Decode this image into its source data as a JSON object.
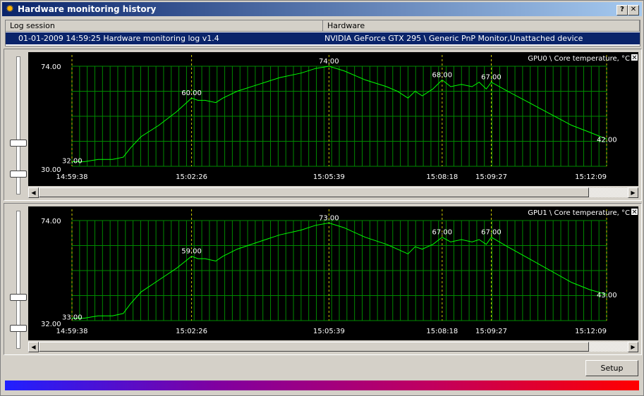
{
  "window": {
    "title": "Hardware monitoring history",
    "help_label": "?",
    "close_label": "✕",
    "app_icon": "gear-icon"
  },
  "table": {
    "col_session": "Log session",
    "col_hardware": "Hardware",
    "row": {
      "session": "01-01-2009 14:59:25 Hardware monitoring log v1.4",
      "hardware": "NVIDIA GeForce GTX 295 \\ Generic PnP Monitor,Unattached device"
    }
  },
  "colors": {
    "graph_bg": "#000000",
    "grid": "#008800",
    "curve": "#00ff00",
    "marker": "#cccc00",
    "text": "#ffffff"
  },
  "setup_label": "Setup",
  "chart_data": [
    {
      "type": "line",
      "title": "GPU0 \\ Core temperature, °C",
      "close_label": "✕",
      "ylim": [
        30,
        74
      ],
      "y_max_label": "74.00",
      "y_min_label": "30.00",
      "x_ticks": [
        "14:59:38",
        "15:02:26",
        "15:05:39",
        "15:08:18",
        "15:09:27",
        "15:12:09"
      ],
      "x_tick_times": [
        "14:59:38",
        "15:02:26",
        "15:05:39",
        "15:08:18",
        "15:09:27",
        "15:12:09"
      ],
      "series": [
        {
          "times": [
            "14:59:38",
            "14:59:55",
            "15:00:15",
            "15:00:35",
            "15:00:50",
            "15:01:00",
            "15:01:15",
            "15:01:40",
            "15:02:05",
            "15:02:26",
            "15:02:35",
            "15:02:45",
            "15:03:00",
            "15:03:10",
            "15:03:30",
            "15:04:00",
            "15:04:30",
            "15:05:00",
            "15:05:20",
            "15:05:39",
            "15:06:00",
            "15:06:30",
            "15:07:00",
            "15:07:15",
            "15:07:30",
            "15:07:40",
            "15:07:50",
            "15:08:05",
            "15:08:18",
            "15:08:30",
            "15:08:45",
            "15:09:00",
            "15:09:10",
            "15:09:20",
            "15:09:27",
            "15:09:50",
            "15:10:20",
            "15:10:50",
            "15:11:20",
            "15:11:45",
            "15:12:09"
          ],
          "values": [
            32,
            32,
            33,
            33,
            34,
            38,
            43,
            48,
            54,
            60,
            59,
            59,
            58,
            60,
            63,
            66,
            69,
            71,
            73,
            74,
            72,
            68,
            65,
            63,
            60,
            63,
            61,
            64,
            68,
            65,
            66,
            65,
            67,
            64,
            67,
            63,
            58,
            53,
            48,
            45,
            42
          ]
        }
      ],
      "markers": [
        {
          "time": "14:59:38",
          "label": "32.00"
        },
        {
          "time": "15:02:26",
          "label": "60.00"
        },
        {
          "time": "15:05:39",
          "label": "74.00"
        },
        {
          "time": "15:08:18",
          "label": "68.00"
        },
        {
          "time": "15:09:27",
          "label": "67.00"
        },
        {
          "time": "15:12:09",
          "label": "42.00"
        }
      ]
    },
    {
      "type": "line",
      "title": "GPU1 \\ Core temperature, °C",
      "close_label": "✕",
      "ylim": [
        32,
        74
      ],
      "y_max_label": "74.00",
      "y_min_label": "32.00",
      "x_ticks": [
        "14:59:38",
        "15:02:26",
        "15:05:39",
        "15:08:18",
        "15:09:27",
        "15:12:09"
      ],
      "x_tick_times": [
        "14:59:38",
        "15:02:26",
        "15:05:39",
        "15:08:18",
        "15:09:27",
        "15:12:09"
      ],
      "series": [
        {
          "times": [
            "14:59:38",
            "14:59:55",
            "15:00:15",
            "15:00:35",
            "15:00:50",
            "15:01:00",
            "15:01:15",
            "15:01:40",
            "15:02:05",
            "15:02:26",
            "15:02:35",
            "15:02:45",
            "15:03:00",
            "15:03:10",
            "15:03:30",
            "15:04:00",
            "15:04:30",
            "15:05:00",
            "15:05:20",
            "15:05:39",
            "15:06:00",
            "15:06:30",
            "15:07:00",
            "15:07:15",
            "15:07:30",
            "15:07:40",
            "15:07:50",
            "15:08:05",
            "15:08:18",
            "15:08:30",
            "15:08:45",
            "15:09:00",
            "15:09:10",
            "15:09:20",
            "15:09:27",
            "15:09:50",
            "15:10:20",
            "15:10:50",
            "15:11:20",
            "15:11:45",
            "15:12:09"
          ],
          "values": [
            33,
            33,
            34,
            34,
            35,
            39,
            44,
            49,
            54,
            59,
            58,
            58,
            57,
            59,
            62,
            65,
            68,
            70,
            72,
            73,
            71,
            67,
            64,
            62,
            60,
            63,
            62,
            64,
            67,
            65,
            66,
            65,
            66,
            64,
            67,
            63,
            58,
            53,
            48,
            45,
            43
          ]
        }
      ],
      "markers": [
        {
          "time": "14:59:38",
          "label": "33.00"
        },
        {
          "time": "15:02:26",
          "label": "59.00"
        },
        {
          "time": "15:05:39",
          "label": "73.00"
        },
        {
          "time": "15:08:18",
          "label": "67.00"
        },
        {
          "time": "15:09:27",
          "label": "67.00"
        },
        {
          "time": "15:12:09",
          "label": "43.00"
        }
      ]
    }
  ]
}
